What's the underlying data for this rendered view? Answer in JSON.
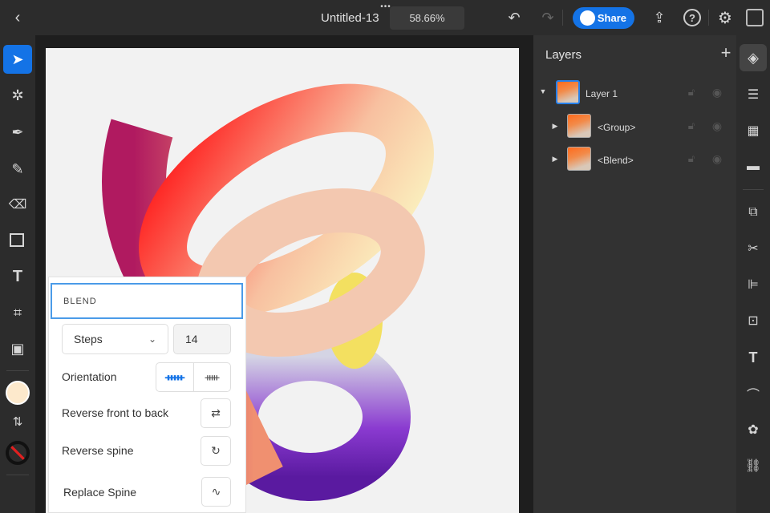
{
  "topbar": {
    "back": "back-icon",
    "doc_title": "Untitled-13",
    "zoom": "58.66%",
    "share_label": "Share"
  },
  "blend_panel": {
    "title": "BLEND",
    "method": "Steps",
    "steps": "14",
    "orientation_label": "Orientation",
    "reverse_front_label": "Reverse front to back",
    "reverse_spine_label": "Reverse spine",
    "replace_spine_label": "Replace Spine"
  },
  "layers": {
    "title": "Layers",
    "items": [
      {
        "name": "Layer 1",
        "expanded": true
      },
      {
        "name": "<Group>",
        "expanded": false
      },
      {
        "name": "<Blend>",
        "expanded": false
      }
    ]
  },
  "colors": {
    "accent": "#1473e6",
    "fill": "#fde9cc"
  }
}
